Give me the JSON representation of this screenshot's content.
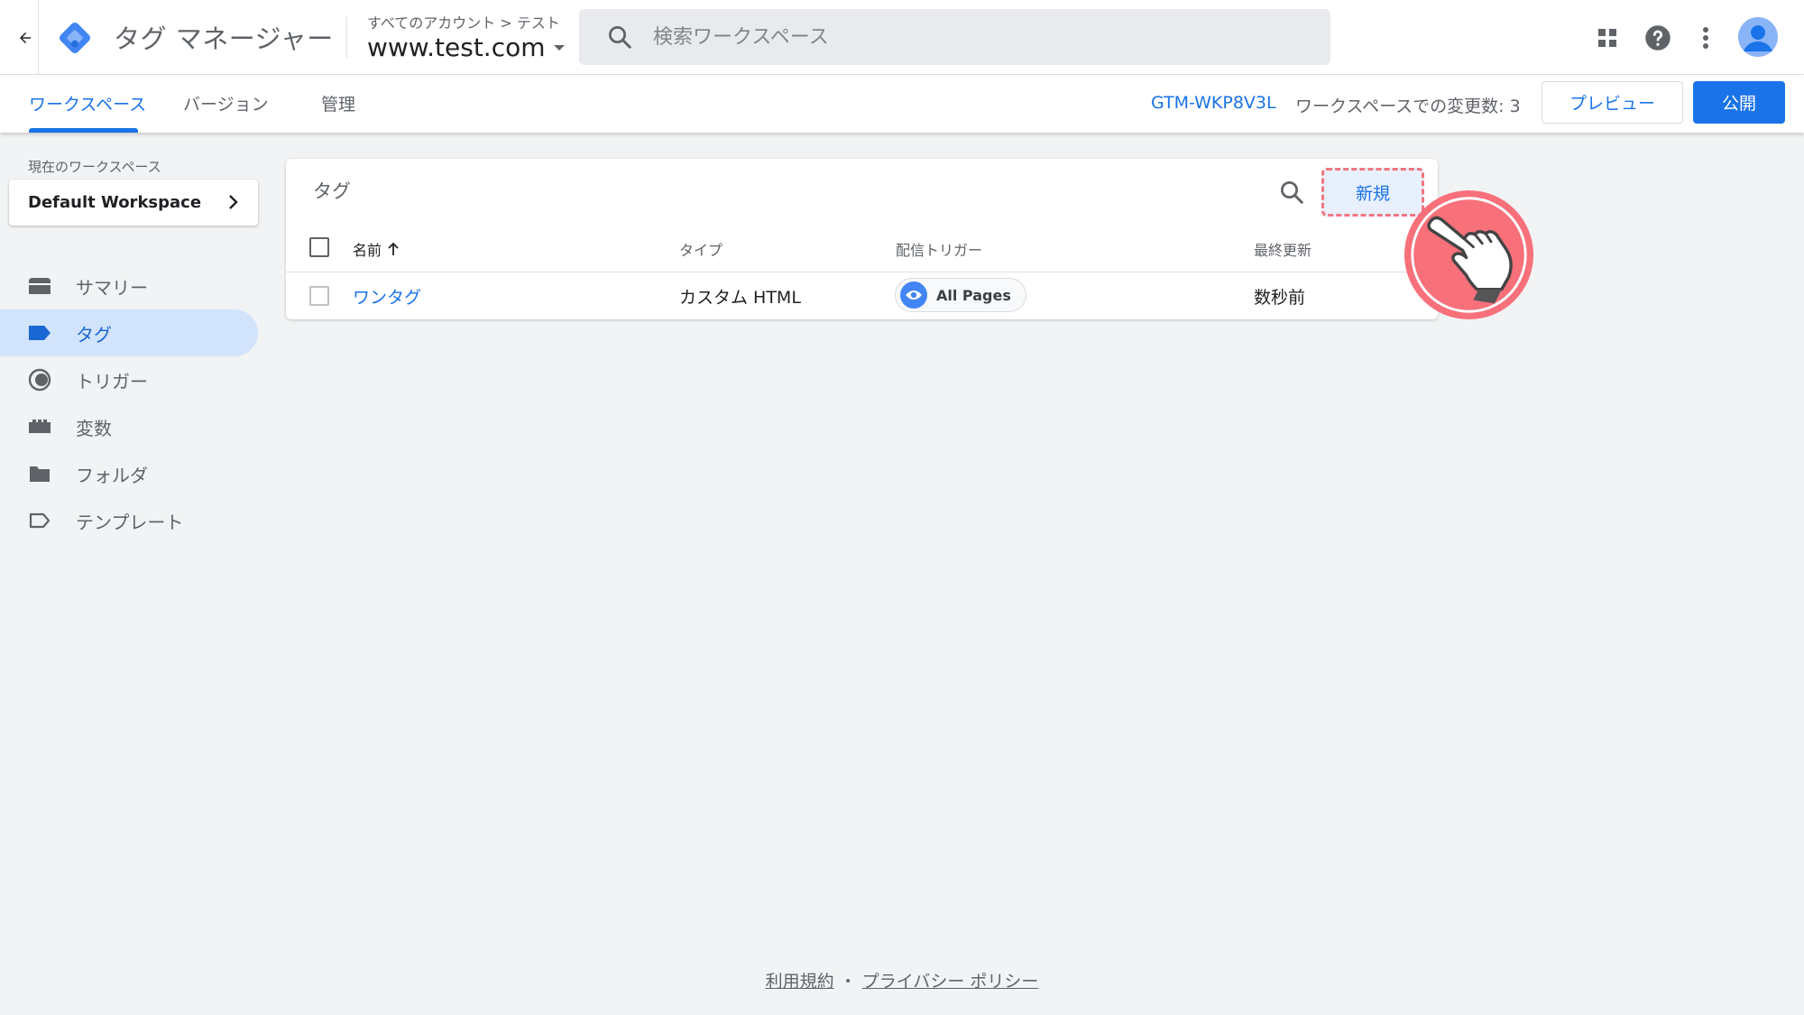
{
  "header": {
    "app_title": "タグ マネージャー",
    "breadcrumb": "すべてのアカウント > テスト",
    "container_name": "www.test.com",
    "search_placeholder": "検索ワークスペース"
  },
  "tabs": {
    "items": [
      {
        "label": "ワークスペース",
        "active": true
      },
      {
        "label": "バージョン",
        "active": false
      },
      {
        "label": "管理",
        "active": false
      }
    ],
    "container_id": "GTM-WKP8V3L",
    "changes_text": "ワークスペースでの変更数: 3",
    "preview_label": "プレビュー",
    "publish_label": "公開"
  },
  "sidebar": {
    "workspace_label": "現在のワークスペース",
    "workspace_name": "Default Workspace",
    "items": [
      {
        "label": "サマリー",
        "icon": "summary-icon",
        "active": false
      },
      {
        "label": "タグ",
        "icon": "tag-icon",
        "active": true
      },
      {
        "label": "トリガー",
        "icon": "trigger-icon",
        "active": false
      },
      {
        "label": "変数",
        "icon": "variables-icon",
        "active": false
      },
      {
        "label": "フォルダ",
        "icon": "folder-icon",
        "active": false
      },
      {
        "label": "テンプレート",
        "icon": "template-icon",
        "active": false
      }
    ]
  },
  "tags_card": {
    "title": "タグ",
    "new_label": "新規",
    "columns": {
      "name": "名前",
      "type": "タイプ",
      "trigger": "配信トリガー",
      "updated": "最終更新"
    },
    "rows": [
      {
        "name": "ワンタグ",
        "type": "カスタム HTML",
        "trigger": "All Pages",
        "updated": "数秒前"
      }
    ]
  },
  "footer": {
    "terms": "利用規約",
    "separator": "・",
    "privacy": "プライバシー ポリシー"
  },
  "colors": {
    "accent": "#1a73e8",
    "active_nav_bg": "#d2e3fc",
    "highlight": "#f07580",
    "hand_circle": "#f7707a"
  }
}
